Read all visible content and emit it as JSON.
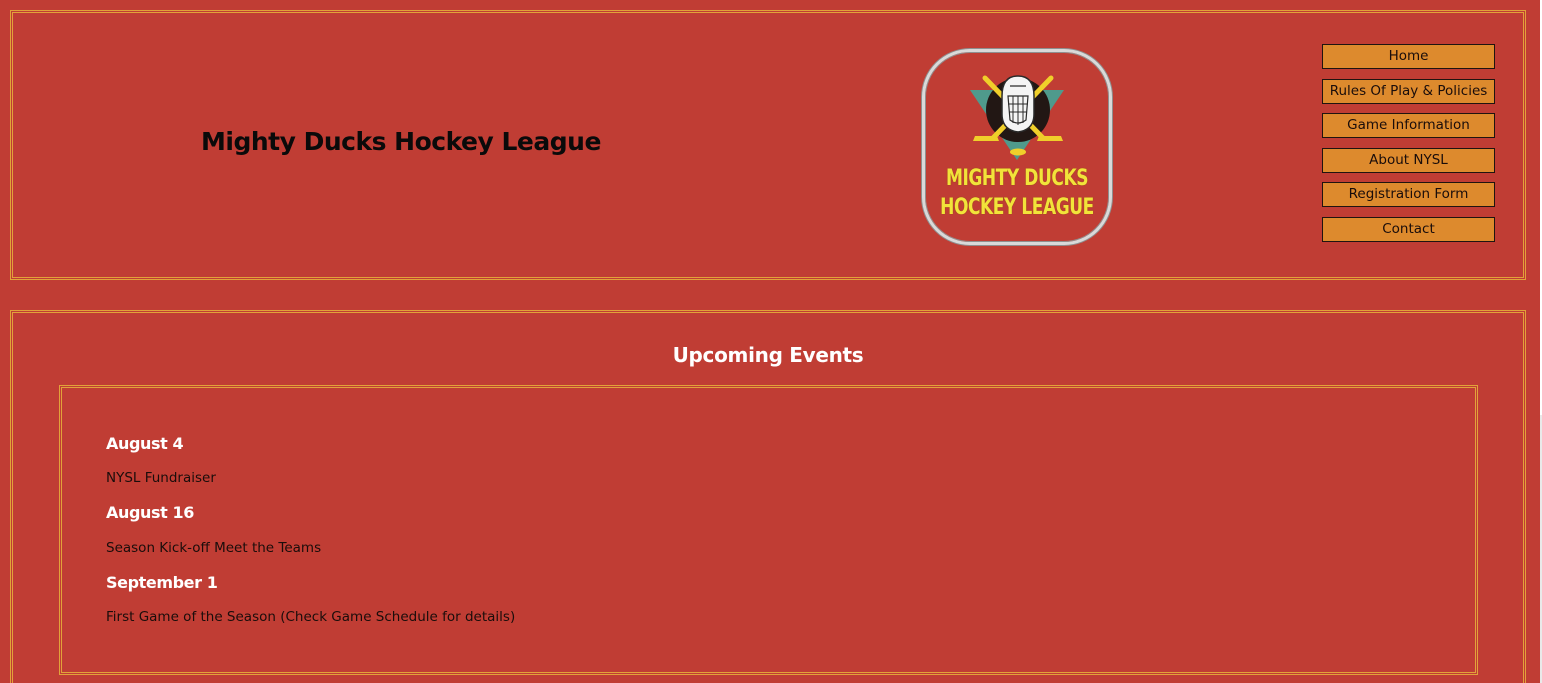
{
  "header": {
    "title": "Mighty Ducks Hockey League",
    "logo": {
      "line1": "MIGHTY DUCKS",
      "line2": "HOCKEY LEAGUE",
      "icon": "goalie-mask-crossed-sticks-icon"
    }
  },
  "nav": {
    "items": [
      {
        "label": "Home"
      },
      {
        "label": "Rules Of Play & Policies"
      },
      {
        "label": "Game Information"
      },
      {
        "label": "About NYSL"
      },
      {
        "label": "Registration Form"
      },
      {
        "label": "Contact"
      }
    ]
  },
  "events": {
    "title": "Upcoming Events",
    "items": [
      {
        "date": "August 4",
        "description": "NYSL Fundraiser"
      },
      {
        "date": "August 16",
        "description": "Season Kick-off Meet the Teams"
      },
      {
        "date": "September 1",
        "description": "First Game of the Season (Check Game Schedule for details)"
      }
    ]
  },
  "colors": {
    "background": "#c03d34",
    "border": "#e2a23a",
    "button": "#dd8a2d",
    "logo_text": "#f2e33a"
  }
}
